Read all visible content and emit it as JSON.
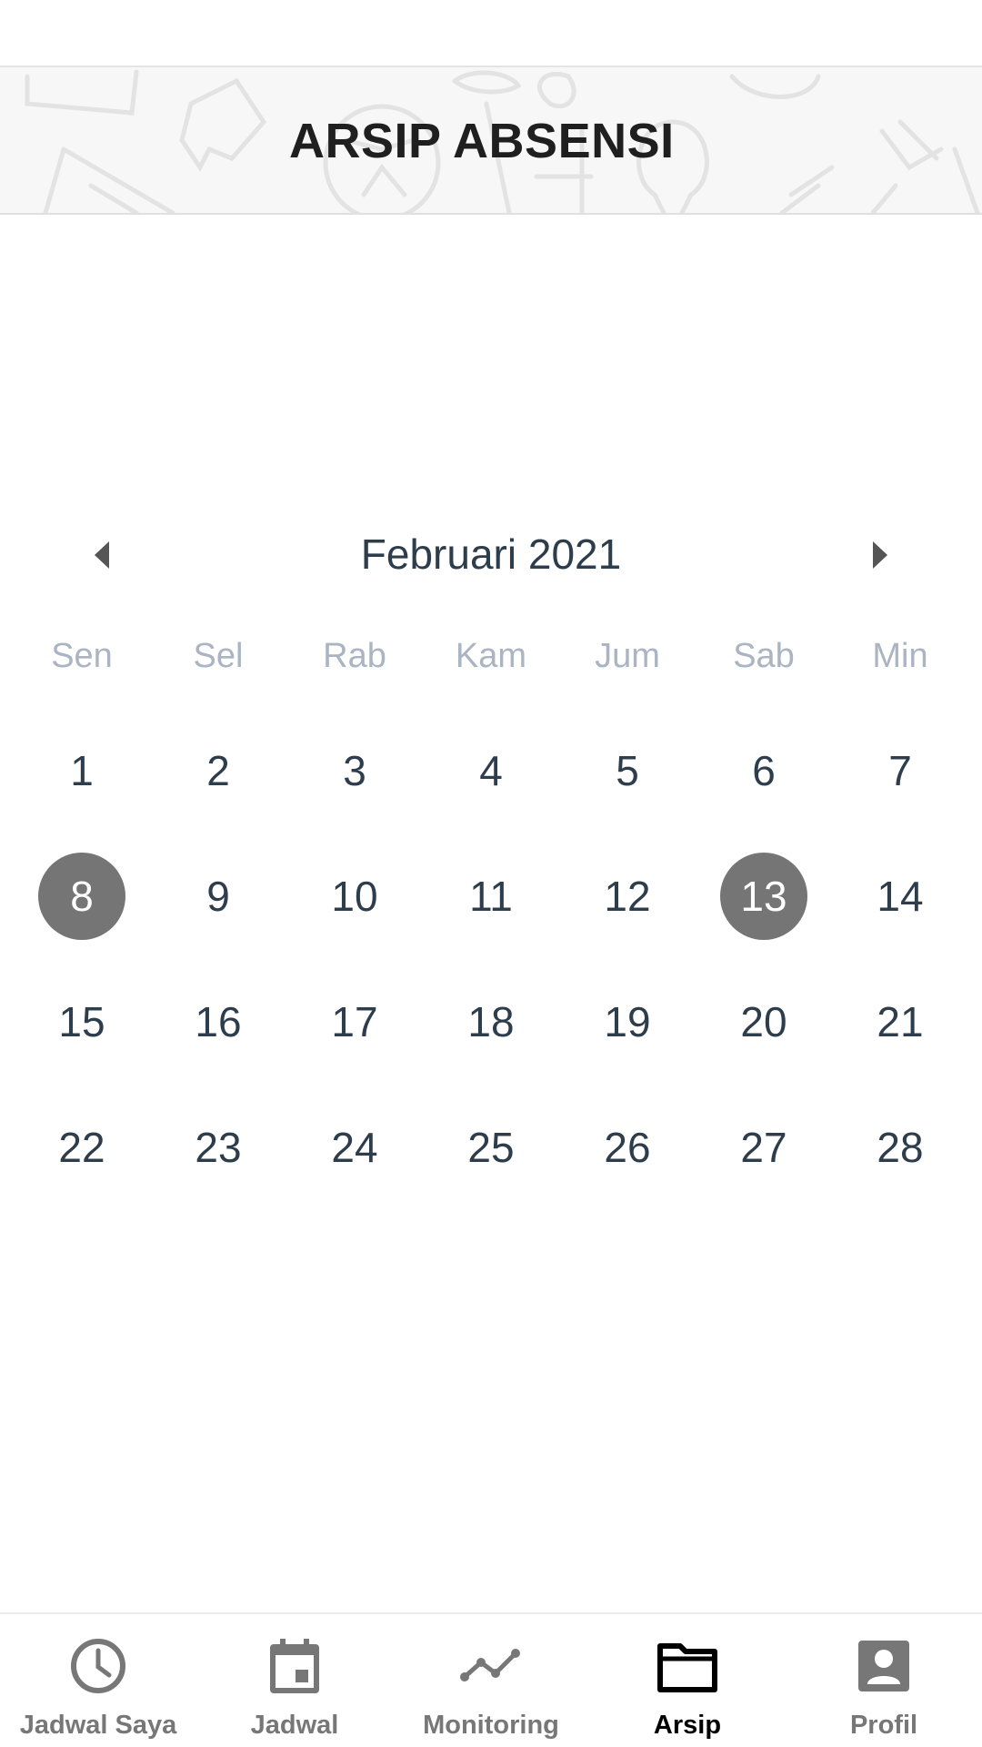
{
  "header": {
    "title": "ARSIP ABSENSI"
  },
  "calendar": {
    "month_label": "Februari 2021",
    "weekdays": [
      "Sen",
      "Sel",
      "Rab",
      "Kam",
      "Jum",
      "Sab",
      "Min"
    ],
    "weeks": [
      [
        "1",
        "2",
        "3",
        "4",
        "5",
        "6",
        "7"
      ],
      [
        "8",
        "9",
        "10",
        "11",
        "12",
        "13",
        "14"
      ],
      [
        "15",
        "16",
        "17",
        "18",
        "19",
        "20",
        "21"
      ],
      [
        "22",
        "23",
        "24",
        "25",
        "26",
        "27",
        "28"
      ]
    ],
    "marked_days": [
      "8",
      "13"
    ],
    "marked_color": "#757575"
  },
  "bottom_nav": {
    "items": [
      {
        "label": "Jadwal Saya",
        "icon": "clock-icon"
      },
      {
        "label": "Jadwal",
        "icon": "calendar-icon"
      },
      {
        "label": "Monitoring",
        "icon": "chart-line-icon"
      },
      {
        "label": "Arsip",
        "icon": "folder-icon"
      },
      {
        "label": "Profil",
        "icon": "profile-icon"
      }
    ],
    "active": "Arsip",
    "active_color": "#000000",
    "inactive_color": "#777777"
  }
}
